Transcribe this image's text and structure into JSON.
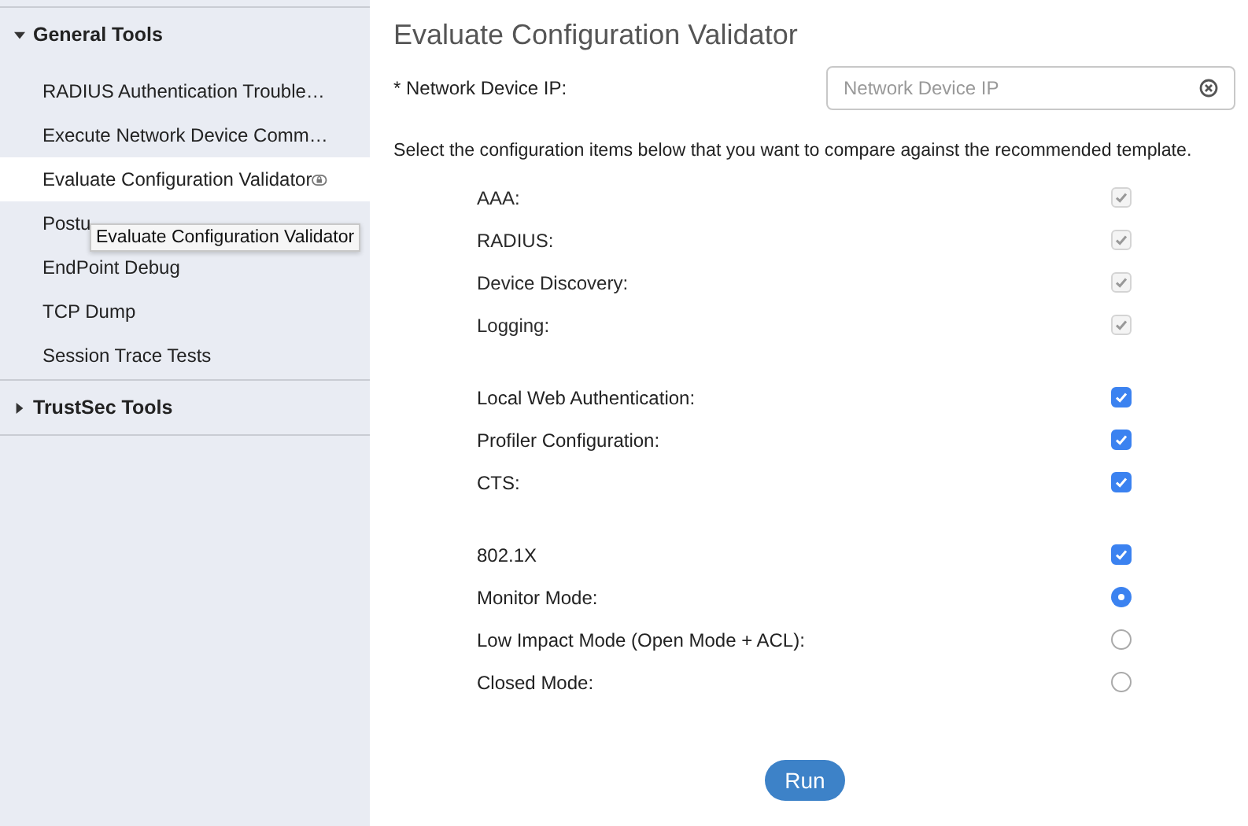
{
  "sidebar": {
    "sections": [
      {
        "title": "General Tools",
        "expanded": true,
        "items": [
          {
            "label": "RADIUS Authentication Trouble…",
            "selected": false,
            "locked": false
          },
          {
            "label": "Execute Network Device Comm…",
            "selected": false,
            "locked": false
          },
          {
            "label": "Evaluate Configuration Validator",
            "selected": true,
            "locked": true
          },
          {
            "label": "Postu",
            "selected": false,
            "locked": false
          },
          {
            "label": "EndPoint Debug",
            "selected": false,
            "locked": false
          },
          {
            "label": "TCP Dump",
            "selected": false,
            "locked": false
          },
          {
            "label": "Session Trace Tests",
            "selected": false,
            "locked": false
          }
        ]
      },
      {
        "title": "TrustSec Tools",
        "expanded": false
      }
    ],
    "tooltip": "Evaluate Configuration Validator"
  },
  "main": {
    "title": "Evaluate Configuration Validator",
    "ip_field": {
      "label": "* Network Device IP:",
      "placeholder": "Network Device IP"
    },
    "instructions": "Select the configuration items below that you want to compare against the recommended template.",
    "groups": [
      [
        {
          "label": "AAA:",
          "kind": "checkbox",
          "checked": true,
          "disabled": true
        },
        {
          "label": "RADIUS:",
          "kind": "checkbox",
          "checked": true,
          "disabled": true
        },
        {
          "label": "Device Discovery:",
          "kind": "checkbox",
          "checked": true,
          "disabled": true
        },
        {
          "label": "Logging:",
          "kind": "checkbox",
          "checked": true,
          "disabled": true
        }
      ],
      [
        {
          "label": "Local Web Authentication:",
          "kind": "checkbox",
          "checked": true,
          "disabled": false
        },
        {
          "label": "Profiler Configuration:",
          "kind": "checkbox",
          "checked": true,
          "disabled": false
        },
        {
          "label": "CTS:",
          "kind": "checkbox",
          "checked": true,
          "disabled": false
        }
      ],
      [
        {
          "label": "802.1X",
          "kind": "checkbox",
          "checked": true,
          "disabled": false
        },
        {
          "label": "Monitor Mode:",
          "kind": "radio",
          "checked": true
        },
        {
          "label": "Low Impact Mode (Open Mode + ACL):",
          "kind": "radio",
          "checked": false
        },
        {
          "label": "Closed Mode:",
          "kind": "radio",
          "checked": false
        }
      ]
    ],
    "run_button": "Run"
  }
}
